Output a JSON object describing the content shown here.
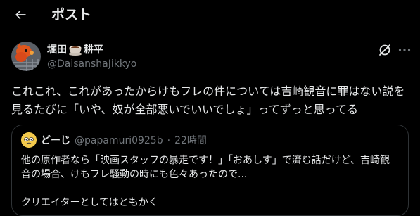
{
  "header": {
    "back_icon": "arrow-left-icon",
    "title": "ポスト"
  },
  "post": {
    "display_name_part1": "堀田",
    "display_name_emoji": "coffee-cup-icon",
    "display_name_part2": "耕平",
    "handle": "@DaisanshaJikkyo",
    "grok_icon": "grok-icon",
    "more_icon": "more-horizontal-icon",
    "text": "これこれ、これがあったからけもフレの件については吉崎観音に罪はない説を見るたびに「いや、奴が全部悪いでいいでしょ」ってずっと思ってる"
  },
  "quote": {
    "name": "どーじ",
    "handle": "@papamuri0925b",
    "separator": "·",
    "time": "22時間",
    "text": "他の原作者なら「映画スタッフの暴走です！」「おあしす」で済む話だけど、吉崎観音の場合、けもフレ騒動の時にも色々あったので...",
    "text_more": "クリエイターとしてはともかく"
  },
  "colors": {
    "background": "#000000",
    "text_primary": "#e7e9ea",
    "text_secondary": "#71767b",
    "border": "#2f3336"
  }
}
